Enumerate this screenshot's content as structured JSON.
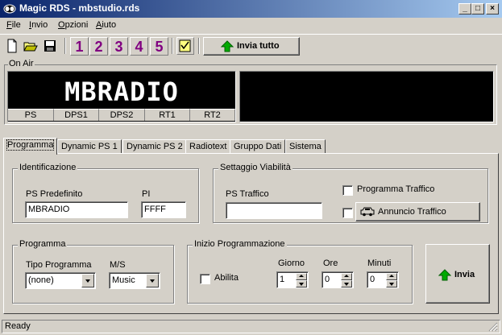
{
  "window": {
    "title": "Magic RDS - mbstudio.rds",
    "minimize": "_",
    "maximize": "□",
    "close": "×"
  },
  "menu": [
    {
      "label": "File",
      "mnemonic": "F",
      "rest": "ile"
    },
    {
      "label": "Invio",
      "mnemonic": "I",
      "rest": "nvio"
    },
    {
      "label": "Opzioni",
      "mnemonic": "O",
      "rest": "pzioni"
    },
    {
      "label": "Aiuto",
      "mnemonic": "A",
      "rest": "iuto"
    }
  ],
  "toolbar": {
    "icons": [
      "new-file-icon",
      "open-folder-icon",
      "save-disk-icon",
      "checklist-icon"
    ],
    "presets": [
      "1",
      "2",
      "3",
      "4",
      "5"
    ],
    "send_all_label": "Invia tutto",
    "preset_color": "#800080",
    "arrow_color": "#00aa00"
  },
  "on_air": {
    "label": "On Air",
    "ps_display": "MBRADIO",
    "display_tabs": [
      "PS",
      "DPS1",
      "DPS2",
      "RT1",
      "RT2"
    ]
  },
  "tabs": [
    {
      "label": "Programma",
      "active": true
    },
    {
      "label": "Dynamic PS 1",
      "active": false
    },
    {
      "label": "Dynamic PS 2",
      "active": false
    },
    {
      "label": "Radiotext",
      "active": false
    },
    {
      "label": "Gruppo Dati",
      "active": false
    },
    {
      "label": "Sistema",
      "active": false
    }
  ],
  "identificazione": {
    "title": "Identificazione",
    "ps_label": "PS Predefinito",
    "ps_value": "MBRADIO",
    "pi_label": "PI",
    "pi_value": "FFFF"
  },
  "viabilita": {
    "title": "Settaggio Viabilità",
    "ps_traffico_label": "PS Traffico",
    "ps_traffico_value": "",
    "programma_traffico_label": "Programma Traffico",
    "programma_traffico_checked": false,
    "annuncio_traffico_label": "Annuncio Traffico",
    "annuncio_traffico_checked": false
  },
  "programma": {
    "title": "Programma",
    "tipo_label": "Tipo Programma",
    "tipo_value": "(none)",
    "ms_label": "M/S",
    "ms_value": "Music"
  },
  "inizio": {
    "title": "Inizio Programmazione",
    "abilita_label": "Abilita",
    "abilita_checked": false,
    "giorno_label": "Giorno",
    "giorno_value": "1",
    "ore_label": "Ore",
    "ore_value": "0",
    "minuti_label": "Minuti",
    "minuti_value": "0"
  },
  "invia_button": "Invia",
  "status": "Ready"
}
